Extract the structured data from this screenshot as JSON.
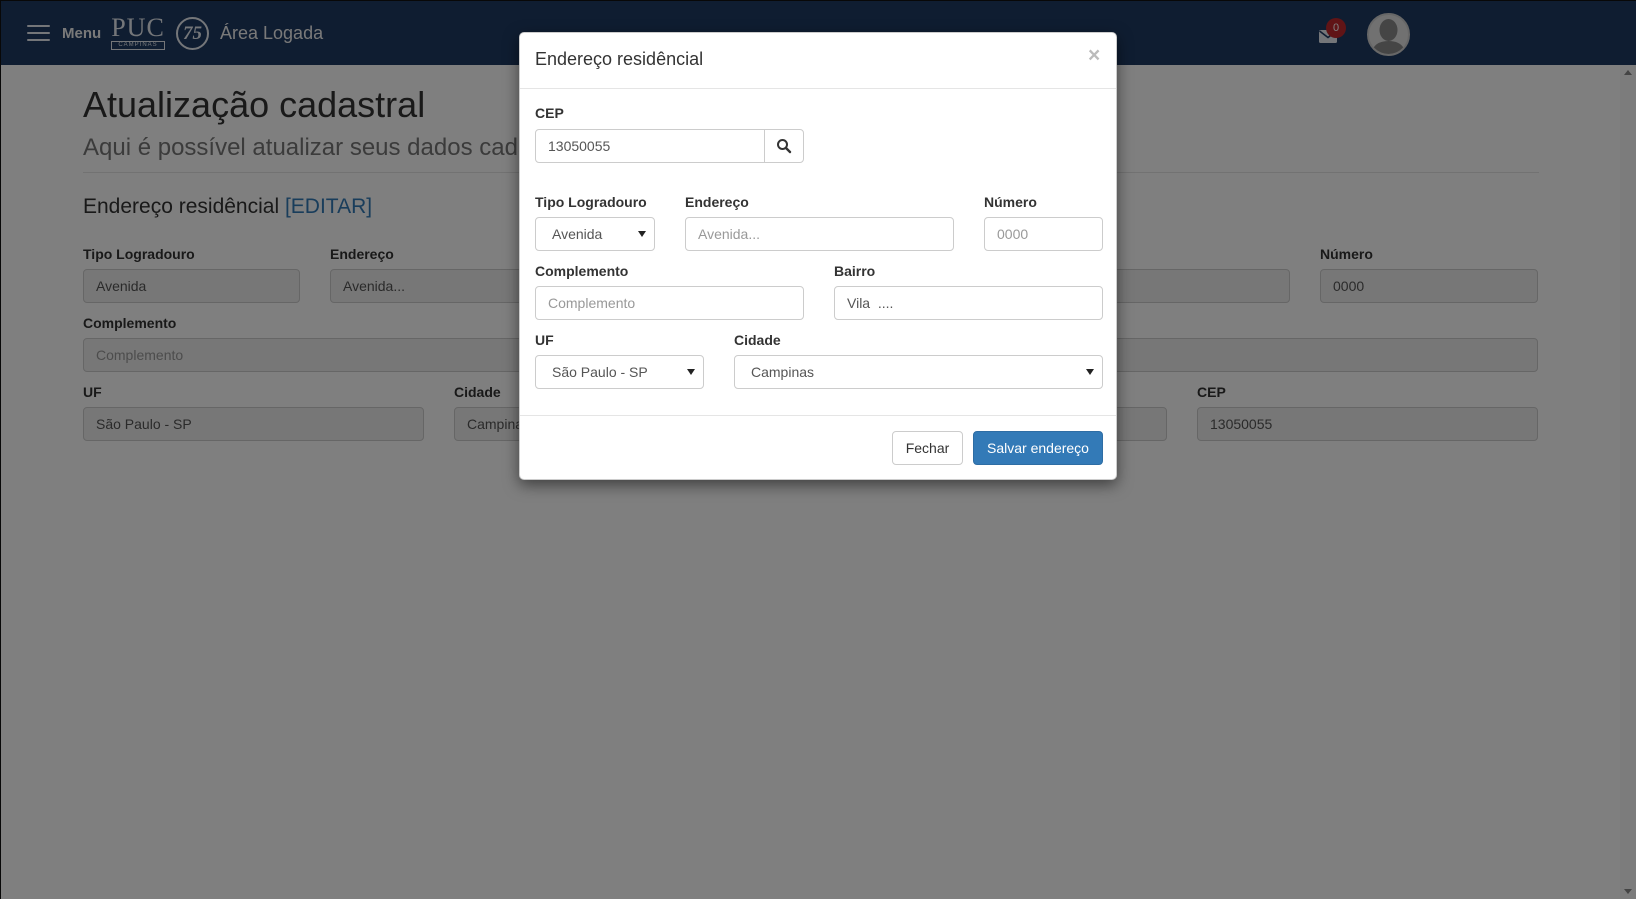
{
  "header": {
    "menu_label": "Menu",
    "logo_text": "PUC",
    "logo_subtext": "CAMPINAS",
    "anniversary_text": "75",
    "area_title": "Área Logada",
    "mail_badge_count": "0",
    "icons": {
      "menu": "hamburger-icon",
      "mail": "envelope-icon",
      "avatar": "user-avatar-icon"
    },
    "colors": {
      "bar": "#1f3b63",
      "badge": "#c0282d"
    }
  },
  "page": {
    "title": "Atualização cadastral",
    "subtitle": "Aqui é possível atualizar seus dados cada",
    "section": {
      "title": "Endereço residêncial",
      "edit_label": "[EDITAR]"
    },
    "fields": {
      "tipo_logradouro": {
        "label": "Tipo Logradouro",
        "value": "Avenida"
      },
      "endereco": {
        "label": "Endereço",
        "value": "Avenida..."
      },
      "numero": {
        "label": "Número",
        "value": "0000"
      },
      "complemento": {
        "label": "Complemento",
        "placeholder": "Complemento"
      },
      "uf": {
        "label": "UF",
        "value": "São Paulo - SP"
      },
      "cidade": {
        "label": "Cidade",
        "value": "Campinas"
      },
      "cep": {
        "label": "CEP",
        "value": "13050055"
      }
    }
  },
  "modal": {
    "title": "Endereço residêncial",
    "close_symbol": "×",
    "cep": {
      "label": "CEP",
      "value": "13050055",
      "search_icon": "search-icon"
    },
    "tipo_logradouro": {
      "label": "Tipo Logradouro",
      "selected": "Avenida"
    },
    "endereco": {
      "label": "Endereço",
      "placeholder": "Avenida..."
    },
    "numero": {
      "label": "Número",
      "placeholder": "0000"
    },
    "complemento": {
      "label": "Complemento",
      "placeholder": "Complemento"
    },
    "bairro": {
      "label": "Bairro",
      "value": "Vila  ...."
    },
    "uf": {
      "label": "UF",
      "selected": "São Paulo - SP"
    },
    "cidade": {
      "label": "Cidade",
      "selected": "Campinas"
    },
    "buttons": {
      "close_label": "Fechar",
      "save_label": "Salvar endereço"
    },
    "colors": {
      "primary": "#337ab7"
    }
  }
}
